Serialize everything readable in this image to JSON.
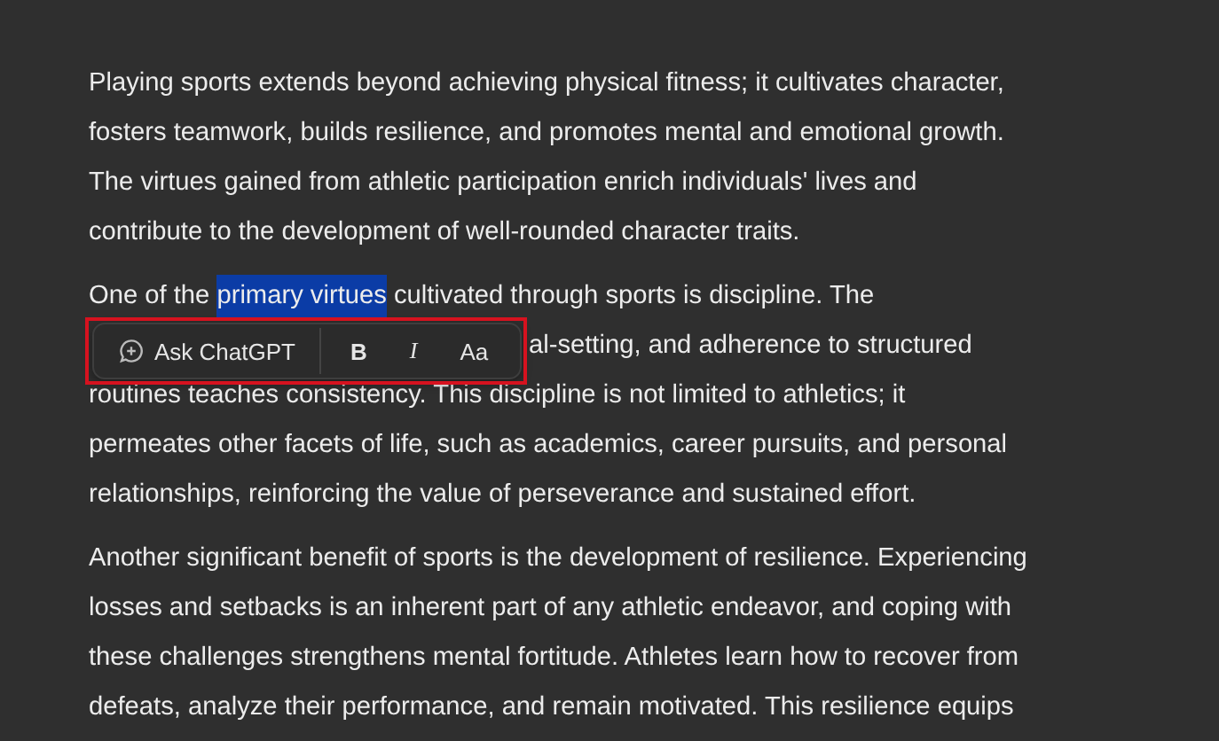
{
  "paragraphs": [
    {
      "lines": [
        {
          "segments": [
            {
              "text": "Playing sports extends beyond achieving physical fitness; it cultivates character,",
              "selected": false
            }
          ]
        },
        {
          "segments": [
            {
              "text": "fosters teamwork, builds resilience, and promotes mental and emotional growth.",
              "selected": false
            }
          ]
        },
        {
          "segments": [
            {
              "text": "The virtues gained from athletic participation enrich individuals' lives and",
              "selected": false
            }
          ]
        },
        {
          "segments": [
            {
              "text": "contribute to the development of well-rounded character traits.",
              "selected": false
            }
          ]
        }
      ]
    },
    {
      "lines": [
        {
          "segments": [
            {
              "text": "One of the ",
              "selected": false
            },
            {
              "text": "primary virtues",
              "selected": true
            },
            {
              "text": " cultivated through sports is discipline. The",
              "selected": false
            }
          ]
        },
        {
          "covered": true,
          "segments": [
            {
              "text": "al-setting, and adherence to structured",
              "selected": false
            }
          ]
        },
        {
          "segments": [
            {
              "text": "routines teaches consistency. This discipline is not limited to athletics; it",
              "selected": false
            }
          ]
        },
        {
          "segments": [
            {
              "text": "permeates other facets of life, such as academics, career pursuits, and personal",
              "selected": false
            }
          ]
        },
        {
          "segments": [
            {
              "text": "relationships, reinforcing the value of perseverance and sustained effort.",
              "selected": false
            }
          ]
        }
      ]
    },
    {
      "lines": [
        {
          "segments": [
            {
              "text": "Another significant benefit of sports is the development of resilience. Experiencing",
              "selected": false
            }
          ]
        },
        {
          "segments": [
            {
              "text": "losses and setbacks is an inherent part of any athletic endeavor, and coping with",
              "selected": false
            }
          ]
        },
        {
          "segments": [
            {
              "text": "these challenges strengthens mental fortitude. Athletes learn how to recover from",
              "selected": false
            }
          ]
        },
        {
          "segments": [
            {
              "text": "defeats, analyze their performance, and remain motivated. This resilience equips",
              "selected": false
            }
          ]
        }
      ]
    }
  ],
  "toolbar": {
    "ask_button": "Ask ChatGPT",
    "buttons": [
      {
        "kind": "bold",
        "label": "B"
      },
      {
        "kind": "italic",
        "label": "I"
      },
      {
        "kind": "case",
        "label": "Aa"
      }
    ]
  }
}
